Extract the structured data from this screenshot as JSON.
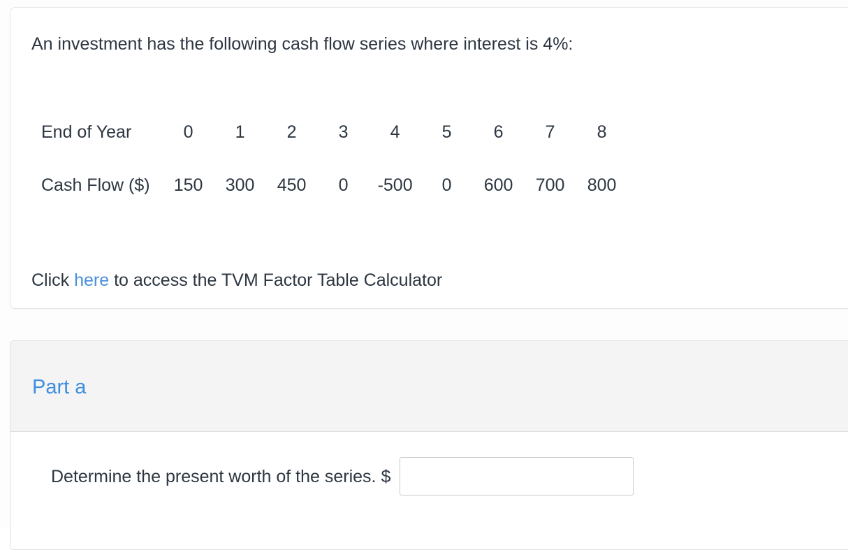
{
  "problem": {
    "prompt": "An investment has the following cash flow series where interest is 4%:",
    "table": {
      "row_labels": [
        "End of Year",
        "Cash Flow ($)"
      ],
      "years": [
        "0",
        "1",
        "2",
        "3",
        "4",
        "5",
        "6",
        "7",
        "8"
      ],
      "cash_flows": [
        "150",
        "300",
        "450",
        "0",
        "-500",
        "0",
        "600",
        "700",
        "800"
      ]
    },
    "link_line": {
      "before": "Click ",
      "link_text": "here",
      "after": " to access the TVM Factor Table Calculator"
    }
  },
  "part": {
    "title": "Part a",
    "question_label": "Determine the present worth of the series. $",
    "answer_value": "",
    "answer_placeholder": ""
  },
  "colors": {
    "text": "#2d3640",
    "link": "#4a90d9",
    "part_title": "#3e8ede",
    "panel_header_bg": "#f4f4f5",
    "card_border": "#e3e4e6",
    "input_border": "#c9c9c9"
  }
}
